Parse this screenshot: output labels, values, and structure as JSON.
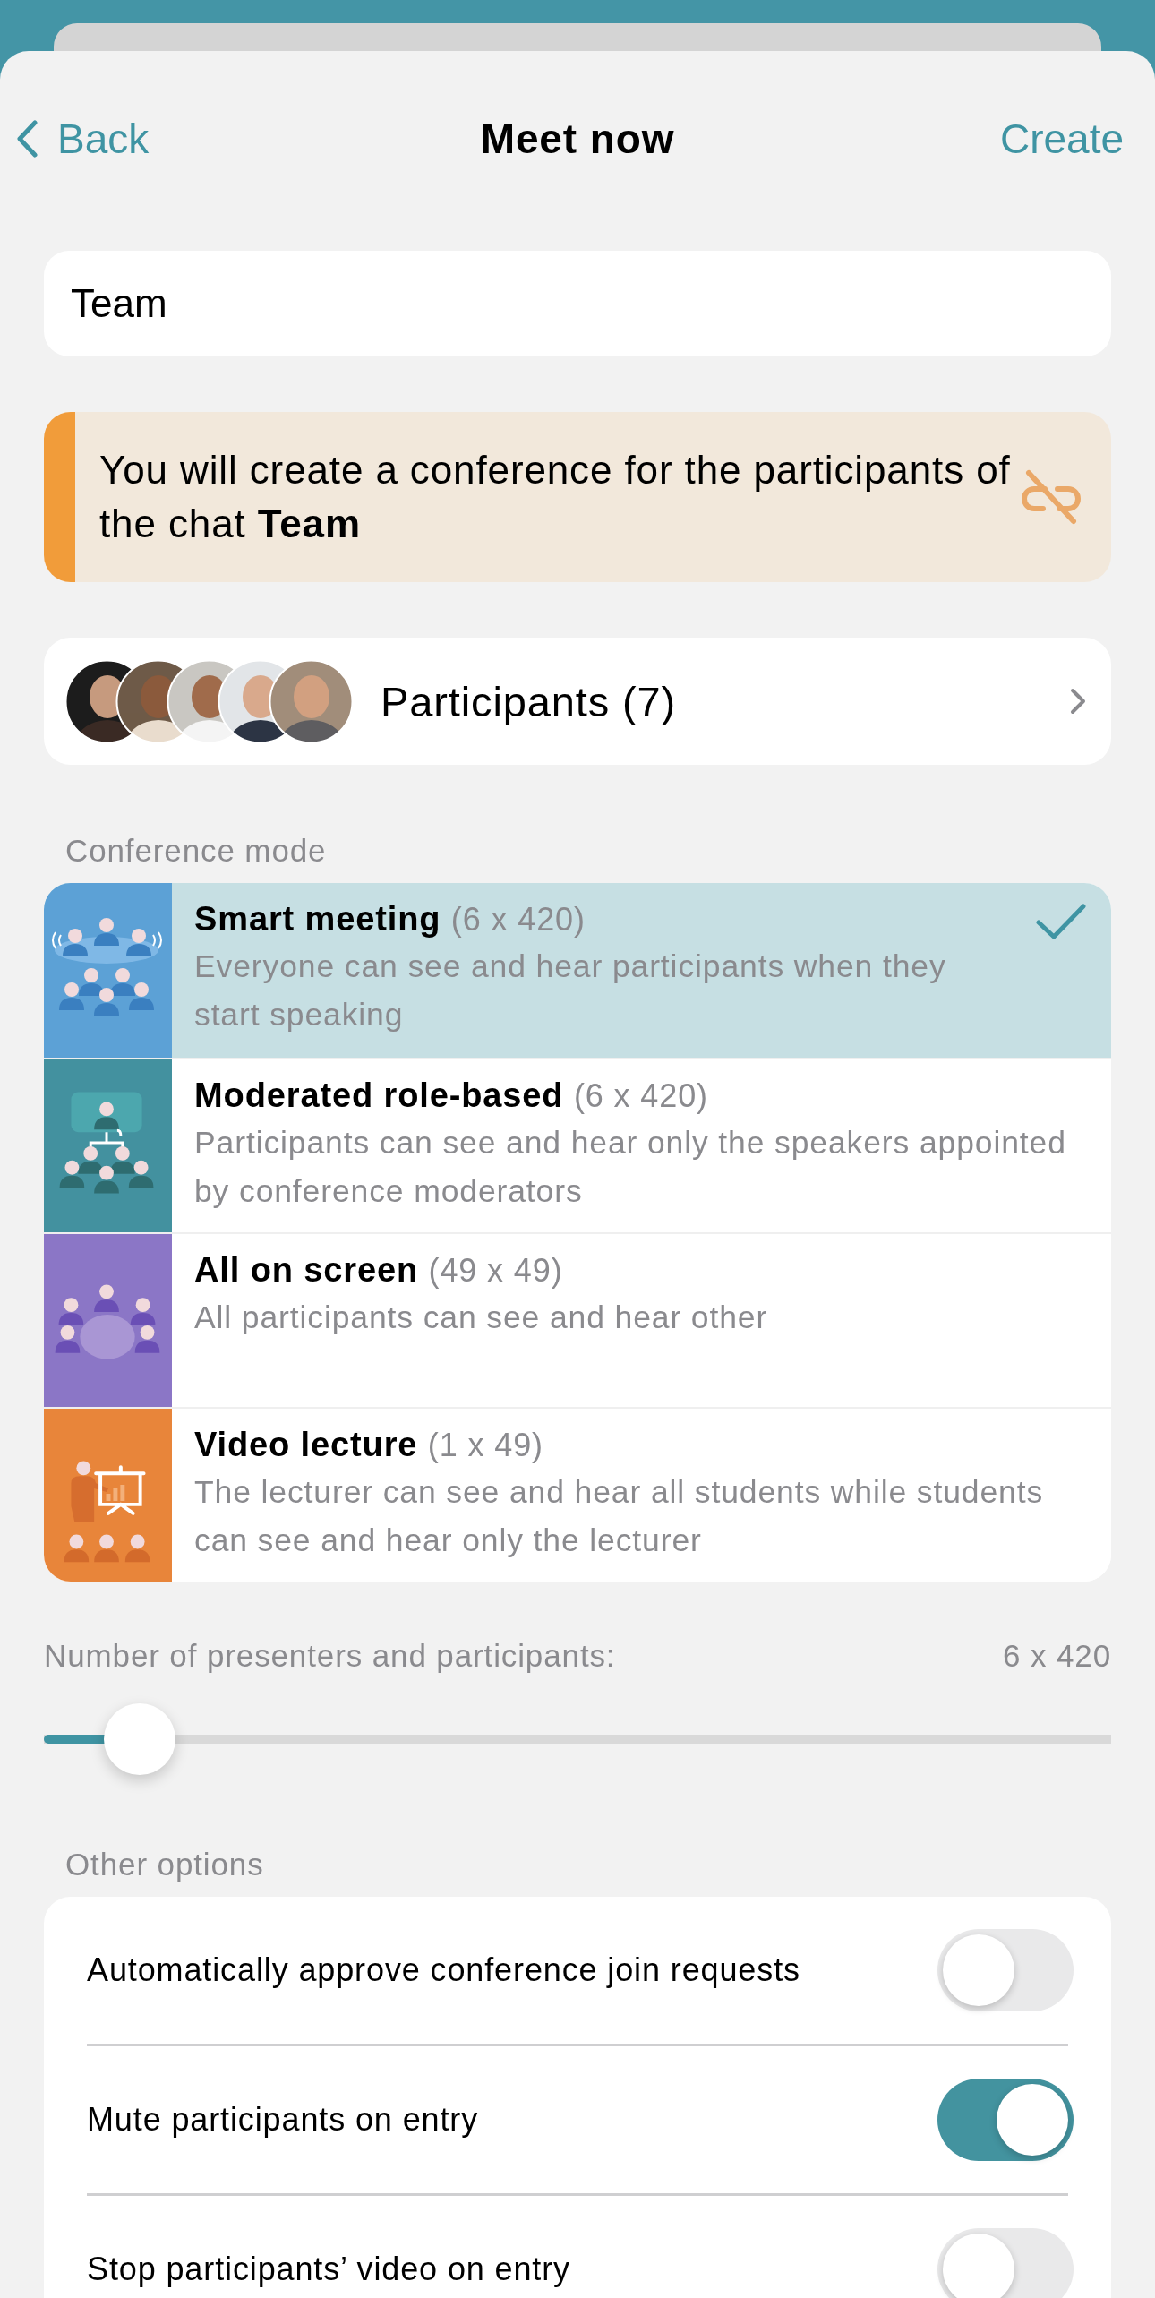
{
  "nav": {
    "back": "Back",
    "title": "Meet now",
    "action": "Create"
  },
  "name_field": {
    "value": "Team"
  },
  "notice": {
    "text": "You will create a conference for the participants of the chat **Team**"
  },
  "participants": {
    "label": "Participants (7)"
  },
  "conference_mode": {
    "heading": "Conference mode",
    "modes": [
      {
        "kind": "smart",
        "title": "Smart meeting",
        "capacity": "(6 x 420)",
        "description": "Everyone can see and hear participants when they start speaking",
        "selected": true,
        "color": "#5ca1d6"
      },
      {
        "kind": "moderated",
        "title": "Moderated role-based",
        "capacity": "(6 x 420)",
        "description": "Participants can see and hear only the speakers appointed by conference moderators",
        "selected": false,
        "color": "#43919f"
      },
      {
        "kind": "all",
        "title": "All on screen",
        "capacity": "(49 x 49)",
        "description": "All participants can see and hear other",
        "selected": false,
        "color": "#8b76c6"
      },
      {
        "kind": "lecture",
        "title": "Video lecture",
        "capacity": "(1 x 49)",
        "description": "The lecturer can see and hear all students while students can see and hear only the lecturer",
        "selected": false,
        "color": "#e8853a"
      }
    ]
  },
  "slider": {
    "label": "Number of presenters and participants:",
    "reading": "6 x 420",
    "level": 0.09
  },
  "other_options": {
    "heading": "Other options",
    "options": [
      {
        "label": "Automatically approve conference join requests",
        "on": false
      },
      {
        "label": "Mute participants on entry",
        "on": true
      },
      {
        "label": "Stop participants’ video on entry",
        "on": false
      }
    ]
  }
}
